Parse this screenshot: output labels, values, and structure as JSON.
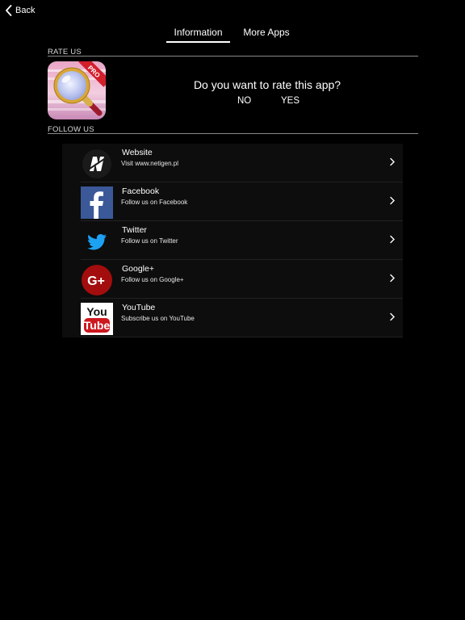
{
  "nav": {
    "back_label": "Back"
  },
  "tabs": [
    {
      "label": "Information",
      "active": true
    },
    {
      "label": "More Apps",
      "active": false
    }
  ],
  "rate": {
    "section_title": "RATE US",
    "question": "Do you want to rate this app?",
    "no_label": "NO",
    "yes_label": "YES",
    "app_badge": "PRO"
  },
  "follow": {
    "section_title": "FOLLOW US",
    "items": [
      {
        "icon": "netigen-logo-icon",
        "title": "Website",
        "subtitle": "Visit www.netigen.pl"
      },
      {
        "icon": "facebook-icon",
        "title": "Facebook",
        "subtitle": "Follow us on Facebook"
      },
      {
        "icon": "twitter-icon",
        "title": "Twitter",
        "subtitle": "Follow us on Twitter"
      },
      {
        "icon": "google-plus-icon",
        "title": "Google+",
        "subtitle": "Follow us on Google+"
      },
      {
        "icon": "youtube-icon",
        "title": "YouTube",
        "subtitle": "Subscribe us on YouTube"
      }
    ]
  },
  "colors": {
    "background": "#000000",
    "list_background": "#0d0d0d",
    "facebook": "#3b5998",
    "twitter": "#1da1f2",
    "google_plus": "#a30d0d",
    "youtube": "#cc181e"
  }
}
